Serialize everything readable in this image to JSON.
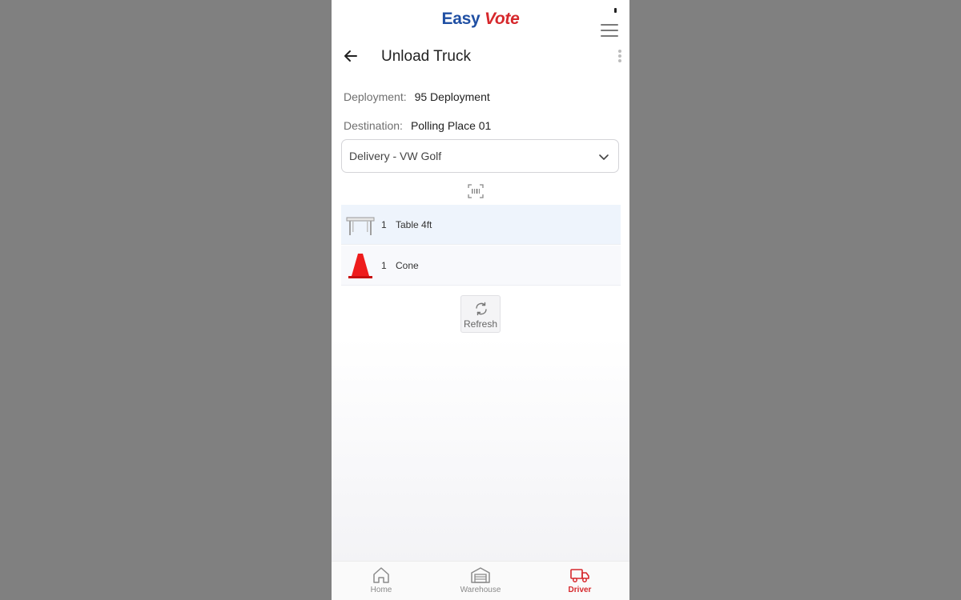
{
  "app": {
    "logo_part1": "Easy",
    "logo_part2": "Vote"
  },
  "header": {
    "title": "Unload Truck"
  },
  "info": {
    "deployment_label": "Deployment:",
    "deployment_value": "95 Deployment",
    "destination_label": "Destination:",
    "destination_value": "Polling Place 01"
  },
  "vehicle_select": {
    "selected": "Delivery - VW Golf"
  },
  "items": [
    {
      "qty": "1",
      "name": "Table 4ft",
      "icon": "table-icon"
    },
    {
      "qty": "1",
      "name": "Cone",
      "icon": "cone-icon"
    }
  ],
  "refresh": {
    "label": "Refresh"
  },
  "bottom_nav": {
    "home": "Home",
    "warehouse": "Warehouse",
    "driver": "Driver",
    "active": "driver"
  },
  "colors": {
    "brand_blue": "#1f4fa3",
    "brand_red": "#d6282c",
    "highlight_row": "#eef4fc"
  }
}
